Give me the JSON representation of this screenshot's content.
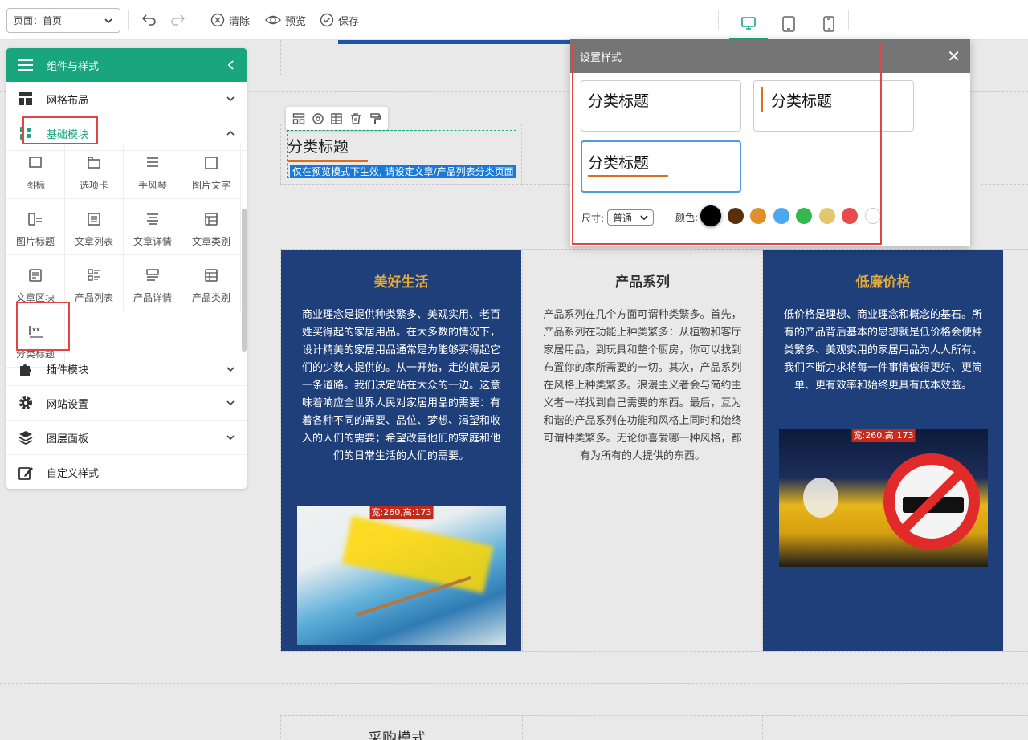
{
  "topbar": {
    "page_select": "页面：首页",
    "clear": "清除",
    "preview": "预览",
    "save": "保存"
  },
  "sidebar": {
    "title": "组件与样式",
    "sections": {
      "grid": "网格布局",
      "basic": "基础模块",
      "plugin": "插件模块",
      "site": "网站设置",
      "layer": "图层面板",
      "custom": "自定义样式"
    },
    "grid_items": [
      {
        "label": "图标",
        "icon": "icon-icon"
      },
      {
        "label": "选项卡",
        "icon": "tabs-icon"
      },
      {
        "label": "手风琴",
        "icon": "accordion-icon"
      },
      {
        "label": "图片文字",
        "icon": "image-text-icon"
      },
      {
        "label": "图片标题",
        "icon": "image-title-icon"
      },
      {
        "label": "文章列表",
        "icon": "article-list-icon"
      },
      {
        "label": "文章详情",
        "icon": "article-detail-icon"
      },
      {
        "label": "文章类别",
        "icon": "article-category-icon"
      },
      {
        "label": "文章区块",
        "icon": "article-block-icon"
      },
      {
        "label": "产品列表",
        "icon": "product-list-icon"
      },
      {
        "label": "产品详情",
        "icon": "product-detail-icon"
      },
      {
        "label": "产品类别",
        "icon": "product-category-icon"
      },
      {
        "label": "分类标题",
        "icon": "category-title-icon"
      }
    ]
  },
  "canvas": {
    "category_title": "分类标题",
    "notice": "仅在预览模式下生效, 请设定文章/产品列表分类页面",
    "panels": [
      {
        "title": "美好生活",
        "text": "商业理念是提供种类繁多、美观实用、老百姓买得起的家居用品。在大多数的情况下，设计精美的家居用品通常是为能够买得起它们的少数人提供的。从一开始，走的就是另一条道路。我们决定站在大众的一边。这意味着响应全世界人民对家居用品的需要：有着各种不同的需要、品位、梦想、渴望和收入的人们的需要；希望改善他们的家庭和他们的日常生活的人们的需要。",
        "image_label": "宽:260,高:173"
      },
      {
        "title": "产品系列",
        "text": "产品系列在几个方面可谓种类繁多。首先，产品系列在功能上种类繁多：从植物和客厅家居用品，到玩具和整个厨房，你可以找到布置你的家所需要的一切。其次，产品系列在风格上种类繁多。浪漫主义者会与简约主义者一样找到自己需要的东西。最后，互为和谐的产品系列在功能和风格上同时和始终可谓种类繁多。无论你喜爱哪一种风格，都有为所有的人提供的东西。"
      },
      {
        "title": "低廉价格",
        "text": "低价格是理想、商业理念和概念的基石。所有的产品背后基本的思想就是低价格会使种类繁多、美观实用的家居用品为人人所有。我们不断力求将每一件事情做得更好、更简单、更有效率和始终更具有成本效益。",
        "image_label": "宽:260,高:173"
      }
    ],
    "bottom_title": "采购模式"
  },
  "modal": {
    "title": "设置样式",
    "cards": [
      "分类标题",
      "分类标题",
      "分类标题"
    ],
    "size_label": "尺寸:",
    "size_value": "普通",
    "color_label": "颜色:",
    "colors": [
      "#000000",
      "#5a2d0c",
      "#e0902a",
      "#4aa8ef",
      "#33b84e",
      "#e5c76b",
      "#e84b4b",
      "#ffffff"
    ]
  },
  "accent": {
    "green": "#19a57e",
    "panel_blue": "#1e3f79",
    "gold": "#e3a93a",
    "red_outline": "#e04444",
    "underline": "#d9701f"
  }
}
